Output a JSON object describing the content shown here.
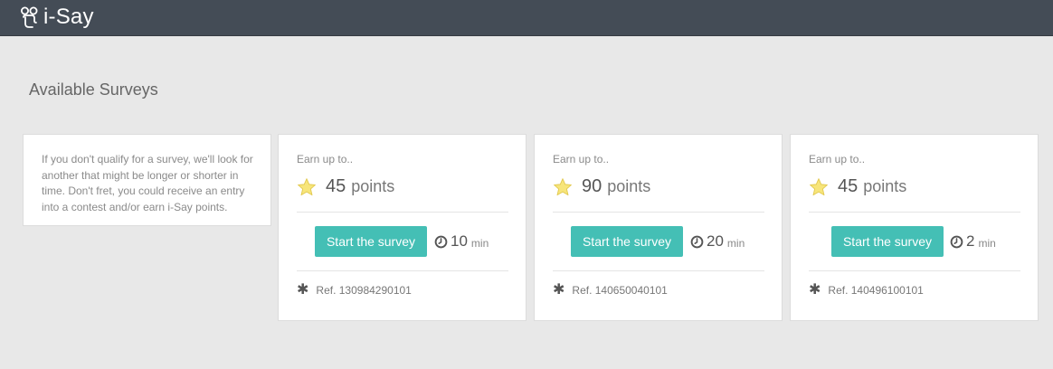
{
  "app": {
    "name": "i-Say"
  },
  "page": {
    "title": "Available Surveys"
  },
  "info": {
    "lines": [
      "If you don't qualify for a survey, we'll look for",
      "another that might be longer or shorter in",
      "time. Don't fret, you could receive an entry",
      "into a contest and/or earn i-Say points."
    ]
  },
  "surveys": [
    {
      "earn_label": "Earn up to..",
      "points": "45",
      "points_label": "points",
      "button_label": "Start the survey",
      "duration": "10",
      "duration_unit": "min",
      "ref": "Ref. 130984290101"
    },
    {
      "earn_label": "Earn up to..",
      "points": "90",
      "points_label": "points",
      "button_label": "Start the survey",
      "duration": "20",
      "duration_unit": "min",
      "ref": "Ref. 140650040101"
    },
    {
      "earn_label": "Earn up to..",
      "points": "45",
      "points_label": "points",
      "button_label": "Start the survey",
      "duration": "2",
      "duration_unit": "min",
      "ref": "Ref. 140496100101"
    }
  ],
  "icons": {
    "logo": "i-say-logo-icon",
    "star": "star-icon",
    "clock": "clock-icon",
    "ref": "asterisk-icon"
  },
  "colors": {
    "header": "#444c56",
    "accent": "#44bfb5",
    "star": "#f7e57a",
    "background": "#e8e8e8"
  }
}
